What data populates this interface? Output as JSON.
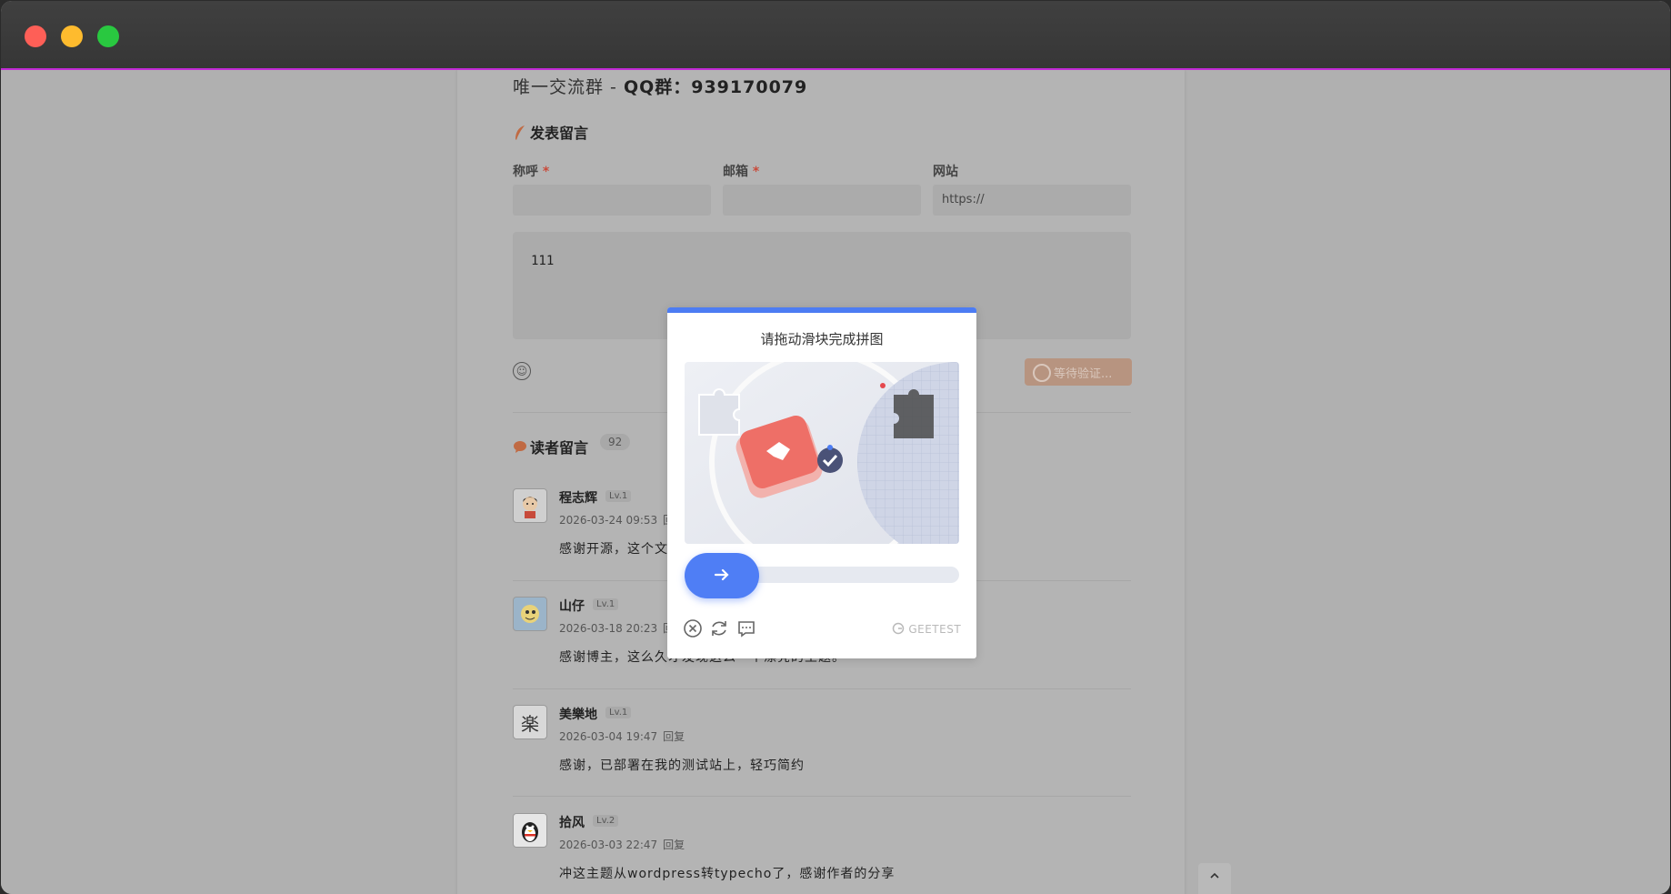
{
  "window": {
    "controls": [
      "close",
      "minimize",
      "maximize"
    ]
  },
  "page": {
    "qq_prefix": "唯一交流群 - ",
    "qq_text": "QQ群：939170079",
    "comment_form": {
      "title": "发表留言",
      "name_label": "称呼",
      "email_label": "邮箱",
      "website_label": "网站",
      "required_mark": "*",
      "name_value": "",
      "email_value": "",
      "website_placeholder": "https://",
      "content_value": "111",
      "submit_label": "等待验证..."
    },
    "comments_section": {
      "title": "读者留言",
      "count": "92",
      "reply_label": "回复",
      "items": [
        {
          "name": "程志辉",
          "level": "Lv.1",
          "date": "2026-03-24 09:53",
          "text": "感谢开源，这个文",
          "avatar": "boy-avatar-icon"
        },
        {
          "name": "山仔",
          "level": "Lv.1",
          "date": "2026-03-18 20:23",
          "text": "感谢博主，这么久才发现这么一个漂亮的主题。",
          "avatar": "cartoon-avatar-icon"
        },
        {
          "name": "美樂地",
          "level": "Lv.1",
          "date": "2026-03-04 19:47",
          "text": "感谢，已部署在我的测试站上，轻巧简约",
          "avatar": "char-avatar-icon",
          "avatar_char": "楽"
        },
        {
          "name": "拾风",
          "level": "Lv.2",
          "date": "2026-03-03 22:47",
          "text": "冲这主题从wordpress转typecho了，感谢作者的分享",
          "avatar": "qq-penguin-avatar-icon"
        }
      ]
    }
  },
  "captcha": {
    "title": "请拖动滑块完成拼图",
    "brand": "GEETEST",
    "accent": "#4c7cf3",
    "controls": [
      "close-icon",
      "refresh-icon",
      "feedback-icon"
    ]
  }
}
